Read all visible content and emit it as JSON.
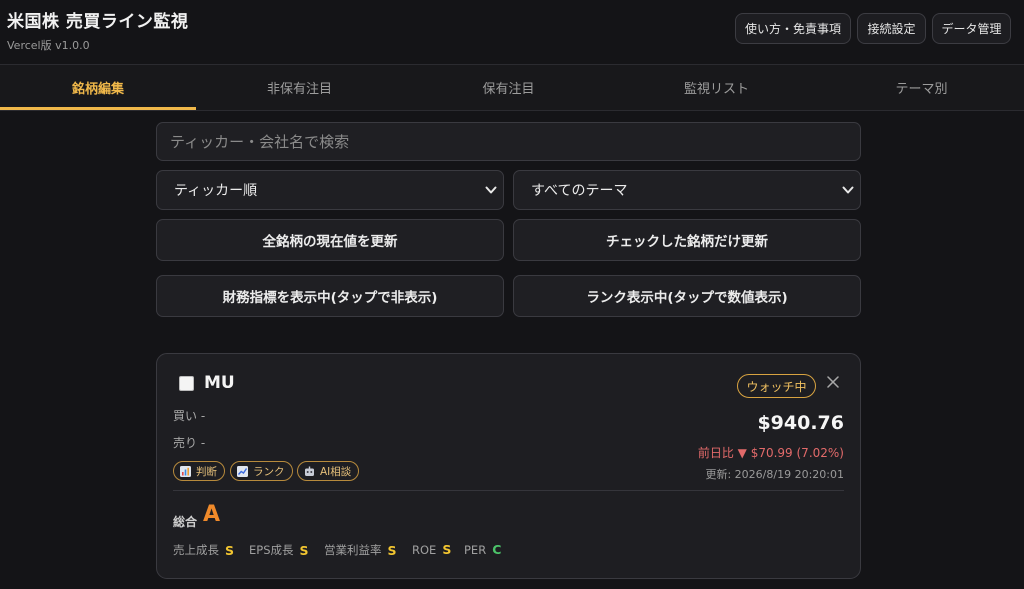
{
  "header": {
    "title": "米国株 売買ライン監視",
    "version": "Vercel版 v1.0.0",
    "buttons": {
      "usage": "使い方・免責事項",
      "connection": "接続設定",
      "data": "データ管理"
    }
  },
  "tabs": [
    {
      "label": "銘柄編集",
      "active": true
    },
    {
      "label": "非保有注目",
      "active": false
    },
    {
      "label": "保有注目",
      "active": false
    },
    {
      "label": "監視リスト",
      "active": false
    },
    {
      "label": "テーマ別",
      "active": false
    }
  ],
  "search": {
    "placeholder": "ティッカー・会社名で検索",
    "value": ""
  },
  "filters": {
    "sort": {
      "selected": "ティッカー順"
    },
    "theme": {
      "selected": "すべてのテーマ"
    }
  },
  "actions": {
    "refresh_all": "全銘柄の現在値を更新",
    "refresh_checked": "チェックした銘柄だけ更新",
    "toggle_financials": "財務指標を表示中(タップで非表示)",
    "toggle_rank": "ランク表示中(タップで数値表示)"
  },
  "stock_card": {
    "ticker": "MU",
    "checked": false,
    "watch_badge": "ウォッチ中",
    "buy": "買い -",
    "sell": "売り -",
    "price": "$940.76",
    "change": "前日比 ▼ $70.99 (7.02%)",
    "updated": "更新: 2026/8/19 20:20:01",
    "pills": {
      "judge": "判断",
      "rank": "ランク",
      "ai": "AI相談"
    },
    "overall": {
      "label": "総合",
      "grade": "A"
    },
    "metrics": [
      {
        "label": "売上成長",
        "grade": "S"
      },
      {
        "label": "EPS成長",
        "grade": "S"
      },
      {
        "label": "営業利益率",
        "grade": "S"
      },
      {
        "label": "ROE",
        "grade": "S"
      },
      {
        "label": "PER",
        "grade": "C"
      }
    ],
    "colors": {
      "accent": "#f0b84a",
      "down": "#e26a6a",
      "grade_s": "#f2c530",
      "grade_c": "#4cc46a",
      "grade_a": "#f08a2a"
    }
  }
}
